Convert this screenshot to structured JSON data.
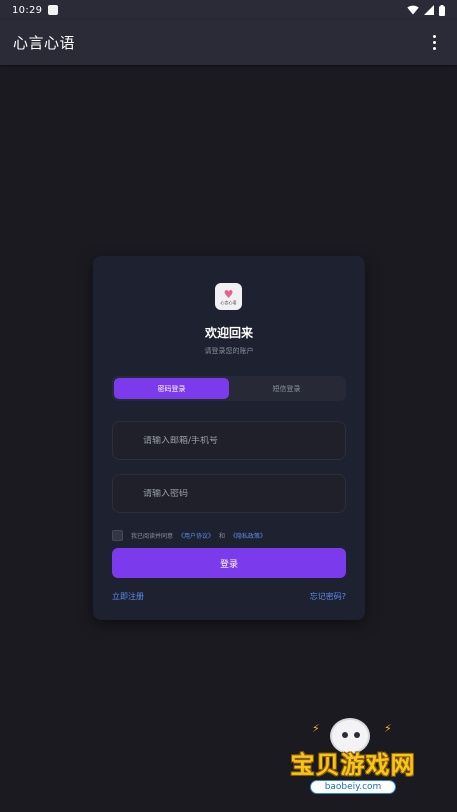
{
  "status_bar": {
    "time": "10:29"
  },
  "app_bar": {
    "title": "心言心语",
    "menu_icon": "more-vert-icon"
  },
  "login": {
    "logo_text": "心言心语",
    "title": "欢迎回来",
    "subtitle": "请登录您的账户",
    "tabs": [
      {
        "label": "密码登录",
        "active": true
      },
      {
        "label": "短信登录",
        "active": false
      }
    ],
    "email_placeholder": "请输入邮箱/手机号",
    "password_placeholder": "请输入密码",
    "agreement": {
      "prefix": "我已阅读并同意",
      "user_agreement": "《用户协议》",
      "and": "和",
      "privacy_policy": "《隐私政策》",
      "checked": false
    },
    "login_button": "登录",
    "register_link": "立即注册",
    "forgot_link": "忘记密码?"
  },
  "colors": {
    "accent": "#7c3aed",
    "link": "#5b8def",
    "background": "#1b1a21",
    "card": "#1e2130",
    "app_bar": "#2a2b36"
  },
  "watermark": {
    "text": "宝贝游戏网",
    "url": "baobeiy.com"
  }
}
